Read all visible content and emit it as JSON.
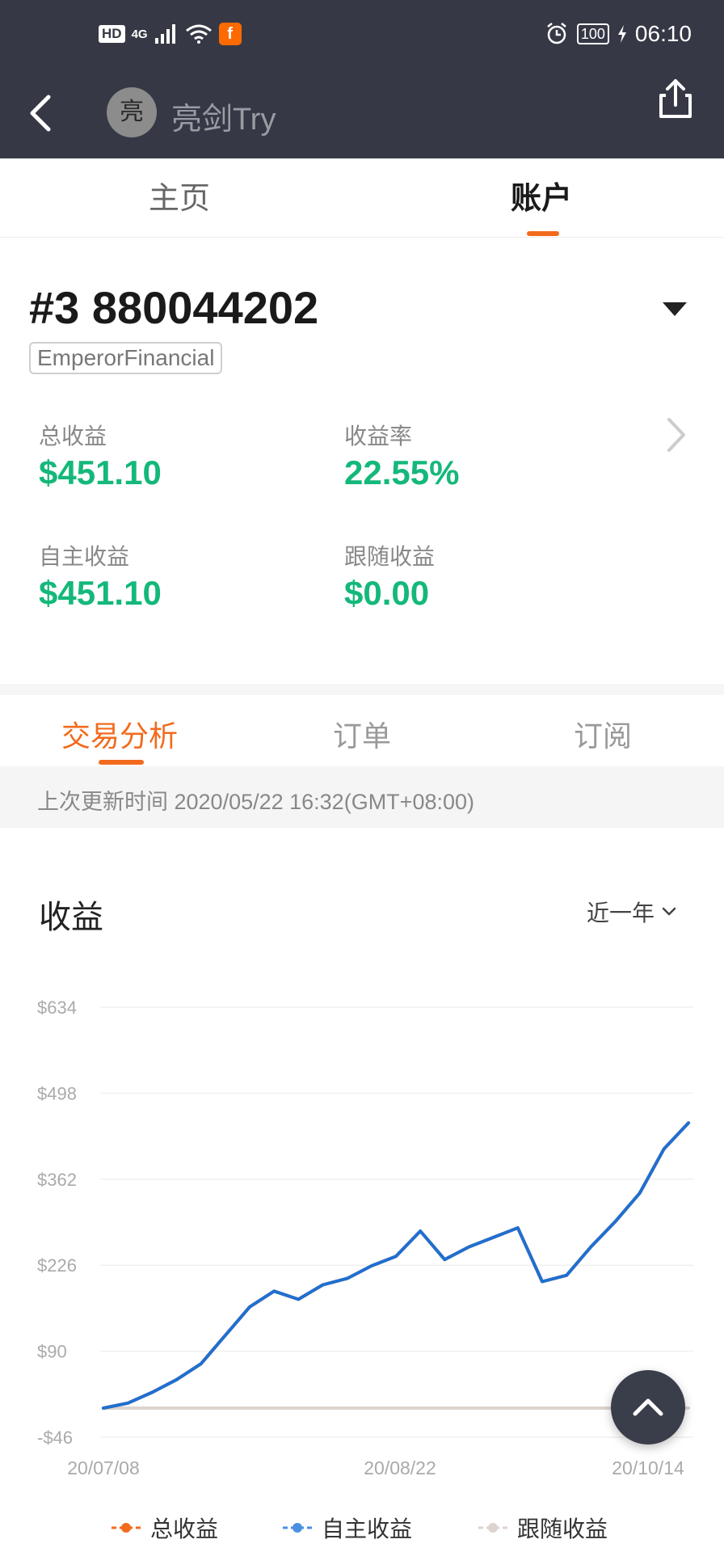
{
  "status_bar": {
    "network_badge": "HD",
    "signal_label": "4G",
    "battery": "100",
    "time": "06:10"
  },
  "nav": {
    "avatar_text": "亮",
    "nickname": "亮剑Try"
  },
  "main_tabs": [
    {
      "label": "主页",
      "active": false
    },
    {
      "label": "账户",
      "active": true
    }
  ],
  "account": {
    "number": "#3 880044202",
    "broker": "EmperorFinancial"
  },
  "stats": {
    "total_profit_label": "总收益",
    "total_profit_value": "$451.10",
    "rate_label": "收益率",
    "rate_value": "22.55%",
    "self_profit_label": "自主收益",
    "self_profit_value": "$451.10",
    "follow_profit_label": "跟随收益",
    "follow_profit_value": "$0.00"
  },
  "sub_tabs": [
    {
      "label": "交易分析",
      "active": true
    },
    {
      "label": "订单",
      "active": false
    },
    {
      "label": "订阅",
      "active": false
    }
  ],
  "last_updated": "上次更新时间 2020/05/22 16:32(GMT+08:00)",
  "chart_section": {
    "title": "收益",
    "range": "近一年"
  },
  "colors": {
    "accent_orange": "#f26b1d",
    "profit_green": "#14b87a",
    "series_self": "#1f6fd1",
    "series_follow": "#ddd3cf"
  },
  "chart_data": {
    "type": "line",
    "title": "",
    "xlabel": "",
    "ylabel": "",
    "ylim": [
      -46,
      634
    ],
    "y_ticks": [
      "$634",
      "$498",
      "$362",
      "$226",
      "$90",
      "-$46"
    ],
    "x_tick_labels": [
      "20/07/08",
      "20/08/22",
      "20/10/14"
    ],
    "x": [
      "20/07/08",
      "20/07/13",
      "20/07/18",
      "20/07/23",
      "20/07/28",
      "20/08/02",
      "20/08/05",
      "20/08/08",
      "20/08/10",
      "20/08/12",
      "20/08/14",
      "20/08/18",
      "20/08/21",
      "20/08/22",
      "20/08/23",
      "20/08/28",
      "20/09/05",
      "20/09/14",
      "20/09/22",
      "20/09/24",
      "20/09/27",
      "20/10/02",
      "20/10/06",
      "20/10/10",
      "20/10/14"
    ],
    "series": [
      {
        "name": "总收益",
        "color": "#f26b1d",
        "values": [
          0,
          8,
          25,
          45,
          70,
          115,
          160,
          185,
          172,
          195,
          205,
          225,
          240,
          280,
          235,
          255,
          270,
          285,
          200,
          210,
          255,
          295,
          340,
          410,
          451
        ]
      },
      {
        "name": "自主收益",
        "color": "#1f6fd1",
        "values": [
          0,
          8,
          25,
          45,
          70,
          115,
          160,
          185,
          172,
          195,
          205,
          225,
          240,
          280,
          235,
          255,
          270,
          285,
          200,
          210,
          255,
          295,
          340,
          410,
          451
        ]
      },
      {
        "name": "跟随收益",
        "color": "#ddd3cf",
        "values": [
          0,
          0,
          0,
          0,
          0,
          0,
          0,
          0,
          0,
          0,
          0,
          0,
          0,
          0,
          0,
          0,
          0,
          0,
          0,
          0,
          0,
          0,
          0,
          0,
          0
        ]
      }
    ]
  }
}
